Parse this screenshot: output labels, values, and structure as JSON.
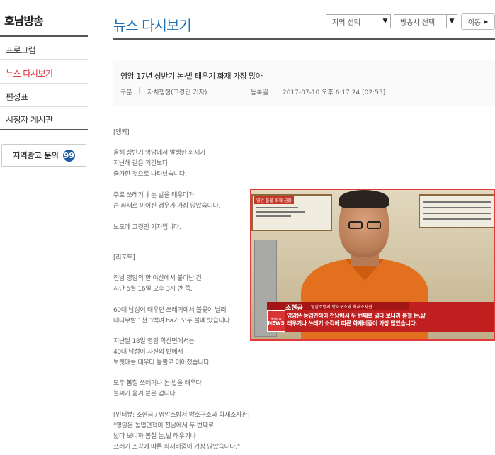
{
  "sidebar": {
    "brand": "호남방송",
    "items": [
      {
        "label": "프로그램"
      },
      {
        "label": "뉴스 다시보기"
      },
      {
        "label": "편성표"
      },
      {
        "label": "시청자 게시판"
      }
    ],
    "ad_button": "지역광고 문의",
    "ad_icon_glyph": "99"
  },
  "header": {
    "title": "뉴스 다시보기",
    "region_select": "지역 선택",
    "station_select": "방송사 선택",
    "go_button": "이동"
  },
  "article": {
    "title": "영암 17년 상반기 논·밭 태우기 화재 가장 많아",
    "category_label": "구분",
    "category_value": "자치행정(고경민 기자)",
    "date_label": "등록일",
    "date_value": "2017-07-10 오후 6:17:24 [02:55]"
  },
  "body": [
    "[앵커]",
    "올해 상반기 영암에서 발생한 화재가\n지난해 같은 기간보다\n증가한 것으로 나타났습니다.",
    "주로 쓰레기나 논 밭을 태우다가\n큰 화재로 이어진 경우가 가장 많았습니다.",
    "보도에 고경민 기자입니다.",
    "[리포트]",
    "전남 영암의 한 야산에서 불이난 건\n지난 5월 16일 오후 3시 반 쯤.",
    "60대 남성이 태우던 쓰레기에서 불꽃이 날려\n대나무밭 1천 3백여 ha가 모두 불에 탔습니다.",
    "지난달 18일 영암 학산면에서는\n40대 남성이 자신의 밭에서\n보릿대를 태우다 들불로 이어졌습니다.",
    "모두 봄철 쓰레기나 논·밭을 태우다\n불씨가 옮겨 붙은 겁니다.",
    "[인터뷰: 조현금 / 영암소방서 방호구조과 화재조사관]\n\"영암은 농업면적이 전남에서 두 번째로\n넓다 보니까 봄철 논,밭 태우기나\n쓰레기 소각에 따른 화재비중이 가장 많았습니다.\""
  ],
  "video": {
    "poster_tag": "영암 들불 화재 급증",
    "channel_logo": "NEWS",
    "caption_name": "조현금",
    "caption_role": "영암소방서 방호구조과 화재조사관",
    "caption_text": "영암은 농업면적이 전남에서 두 번째로 넓다 보니까 봄철 논,밭\n태우기나 쓰레기 소각에 따른 화재비중이 가장 많았습니다.",
    "news_logo_small": "Hello tv",
    "news_logo_big": "NEWS"
  }
}
